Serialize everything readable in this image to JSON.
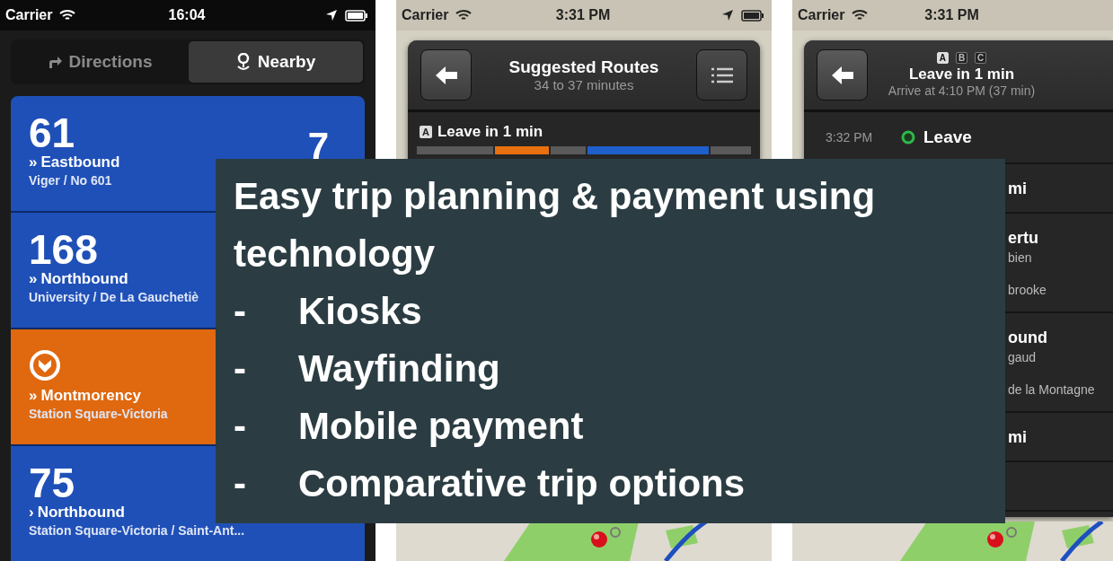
{
  "phones": [
    {
      "kind": "nearby",
      "status": {
        "carrier": "Carrier",
        "time": "16:04",
        "indicators": true
      },
      "tabs": [
        {
          "label": "Directions",
          "selected": false
        },
        {
          "label": "Nearby",
          "selected": true
        }
      ],
      "cards": [
        {
          "kind": "bus",
          "color": "#1f50b8",
          "route": "61",
          "marker": "»",
          "direction": "Eastbound",
          "stop": "Viger / No 601",
          "minutes": "7"
        },
        {
          "kind": "bus",
          "color": "#1f50b8",
          "route": "168",
          "marker": "»",
          "direction": "Northbound",
          "stop": "University / De La Gauchetiè"
        },
        {
          "kind": "metro",
          "color": "#e0680f",
          "marker": "»",
          "direction": "Montmorency",
          "stop": "Station Square-Victoria"
        },
        {
          "kind": "bus",
          "color": "#1f50b8",
          "route": "75",
          "marker": "›",
          "direction": "Northbound",
          "stop": "Station Square-Victoria / Saint-Ant..."
        }
      ]
    },
    {
      "kind": "routes",
      "status": {
        "carrier": "Carrier",
        "time": "3:31 PM",
        "indicators": true
      },
      "title": "Suggested Routes",
      "subtitle": "34 to 37 minutes",
      "option": {
        "badge": "A",
        "label": "Leave in 1 min"
      },
      "segments": [
        {
          "color": "#5a5a5a"
        },
        {
          "color": "#e8700f"
        },
        {
          "color": "#5a5a5a"
        },
        {
          "color": "#1f5fcc"
        },
        {
          "color": "#5a5a5a"
        }
      ]
    },
    {
      "kind": "itinerary",
      "status": {
        "carrier": "Carrier",
        "time": "3:31 PM",
        "indicators": false
      },
      "pages": [
        {
          "label": "A",
          "selected": true
        },
        {
          "label": "B",
          "selected": false
        },
        {
          "label": "C",
          "selected": false
        }
      ],
      "title": "Leave in 1 min",
      "subtitle": "Arrive at 4:10 PM (37 min)",
      "start": {
        "time": "3:32 PM",
        "label": "Leave"
      },
      "rows": [
        {
          "lines": [
            {
              "kind": "title",
              "text": "mi"
            }
          ]
        },
        {
          "lines": [
            {
              "kind": "title",
              "text": "ertu"
            },
            {
              "kind": "sub",
              "text": "bien"
            },
            {
              "kind": "sub",
              "text": "brooke"
            }
          ]
        },
        {
          "lines": [
            {
              "kind": "title",
              "text": "ound"
            },
            {
              "kind": "sub",
              "text": "gaud"
            },
            {
              "kind": "sub",
              "text": "de la Montagne"
            }
          ]
        },
        {
          "lines": [
            {
              "kind": "title",
              "text": "mi"
            }
          ]
        },
        {
          "lines": []
        }
      ]
    }
  ],
  "overlay": {
    "heading": "Easy trip planning & payment using technology",
    "items": [
      {
        "marker": "-",
        "text": "Kiosks"
      },
      {
        "marker": "-",
        "text": "Wayfinding"
      },
      {
        "marker": "-",
        "text": "Mobile payment"
      },
      {
        "marker": "-",
        "text": "Comparative trip options"
      }
    ]
  }
}
